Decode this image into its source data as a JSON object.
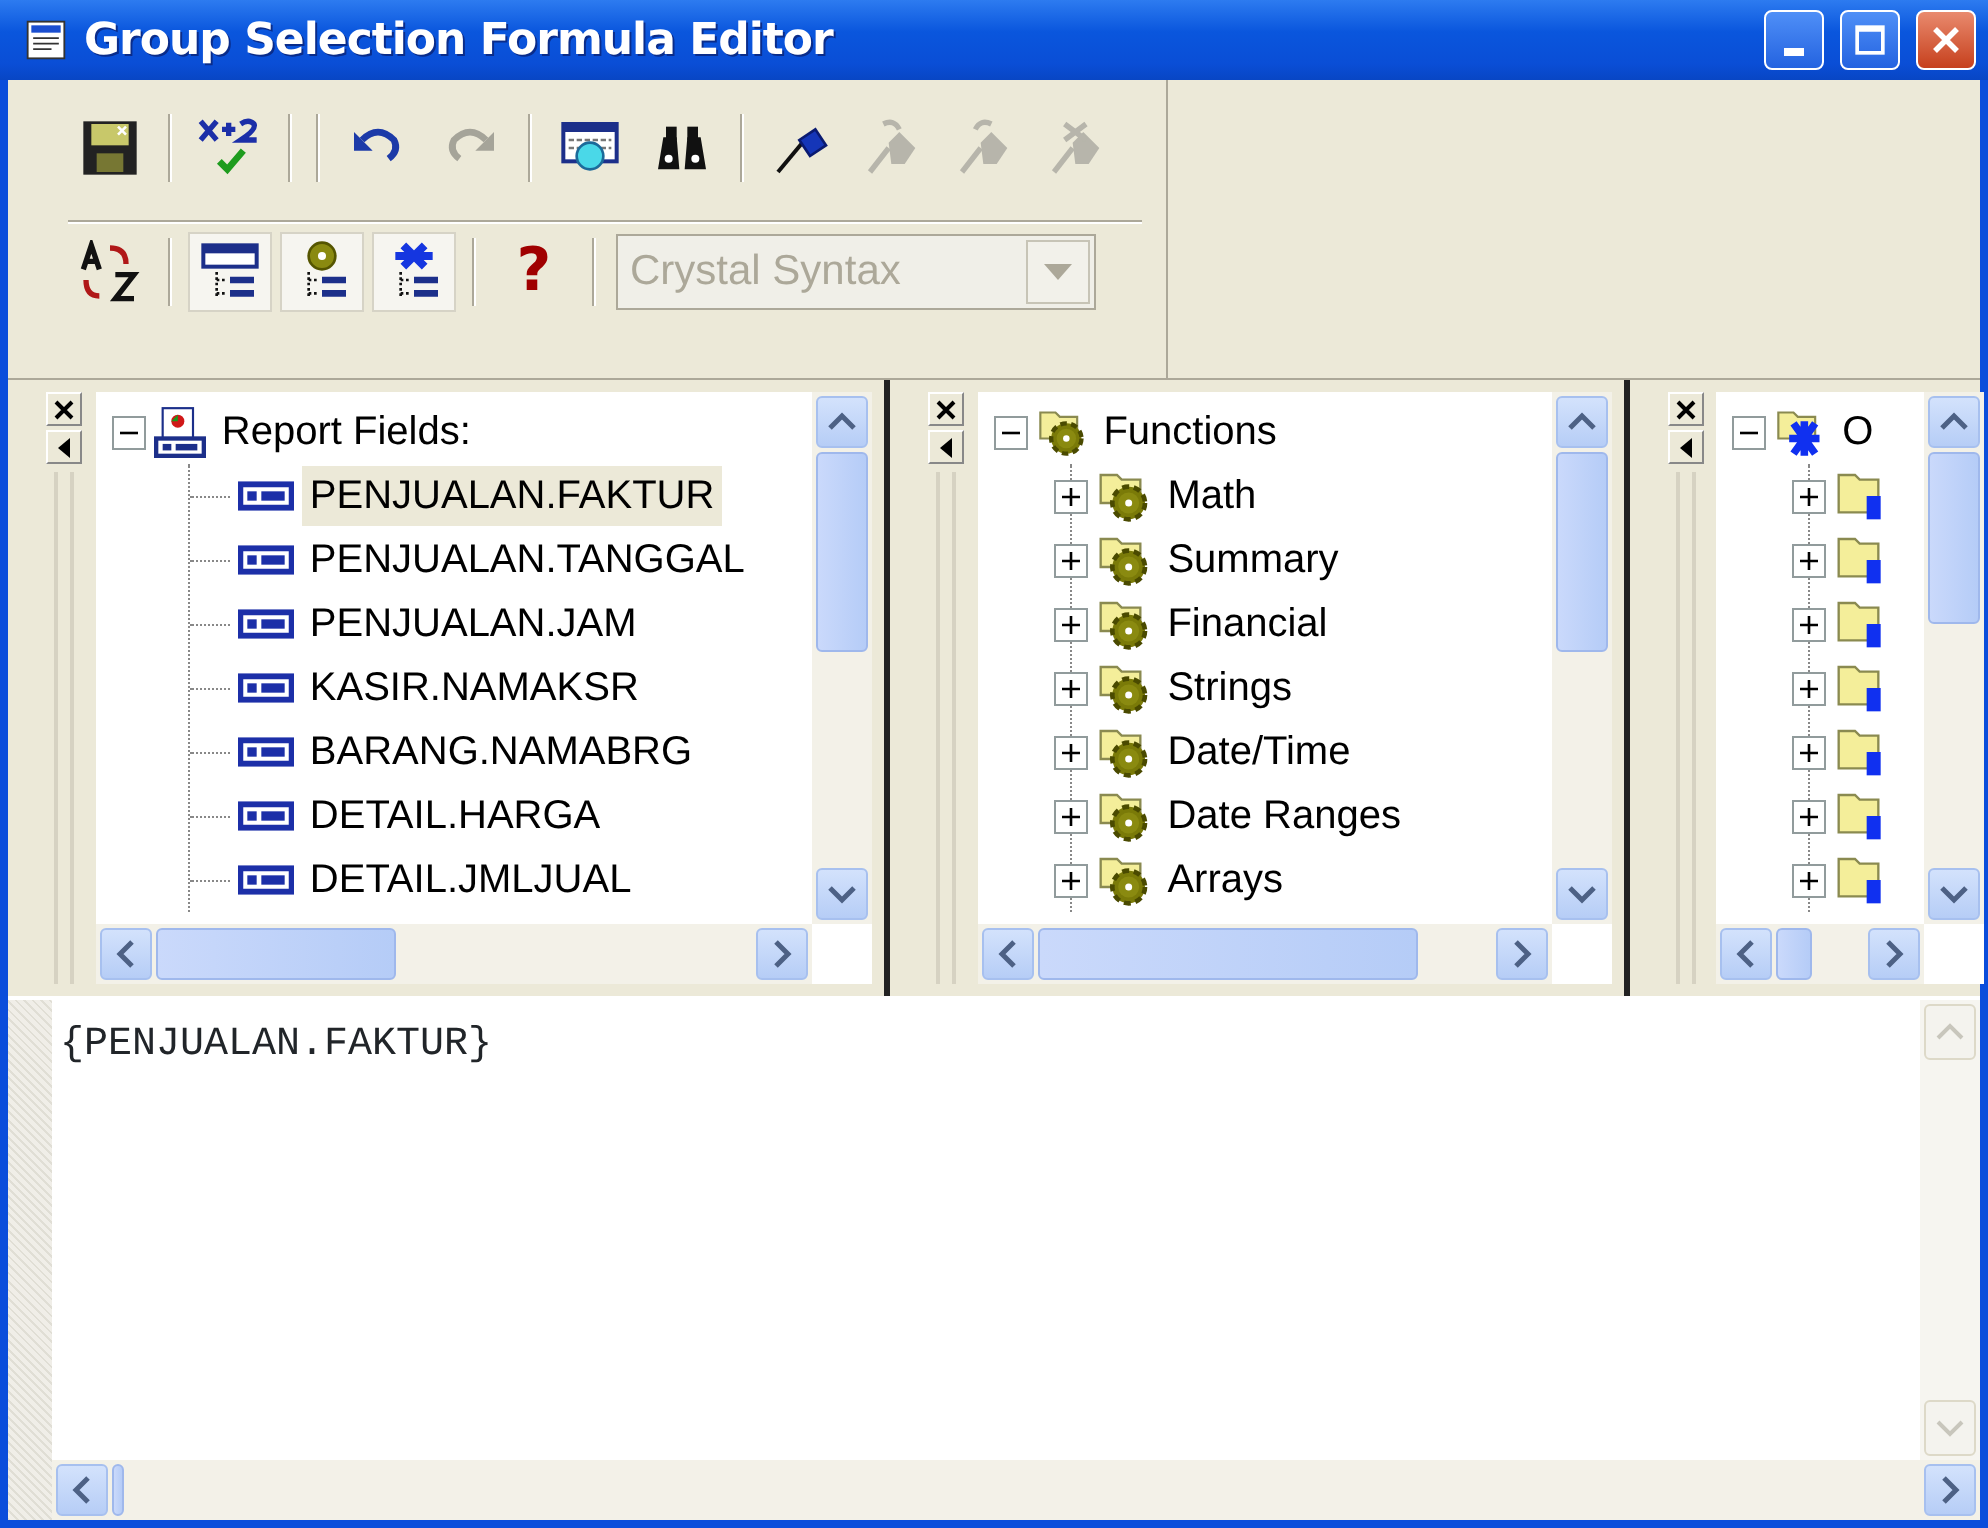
{
  "window": {
    "title": "Group Selection Formula Editor"
  },
  "toolbar": {
    "rows": [
      [
        {
          "kind": "button",
          "disabled": false
        },
        {
          "kind": "separator"
        },
        {
          "kind": "button",
          "disabled": false
        },
        {
          "kind": "separator"
        },
        {
          "kind": "separator"
        },
        {
          "kind": "button",
          "disabled": false
        },
        {
          "kind": "button",
          "disabled": true
        },
        {
          "kind": "separator"
        },
        {
          "kind": "button",
          "disabled": false
        },
        {
          "kind": "button",
          "disabled": false
        },
        {
          "kind": "separator"
        },
        {
          "kind": "button",
          "disabled": false
        },
        {
          "kind": "button",
          "disabled": true
        },
        {
          "kind": "button",
          "disabled": true
        },
        {
          "kind": "button",
          "disabled": true
        }
      ],
      [
        {
          "kind": "button",
          "disabled": false
        },
        {
          "kind": "separator"
        },
        {
          "kind": "toggle",
          "selected": true
        },
        {
          "kind": "toggle",
          "selected": true
        },
        {
          "kind": "toggle",
          "selected": true
        },
        {
          "kind": "separator"
        },
        {
          "kind": "button",
          "disabled": false,
          "label": "?"
        },
        {
          "kind": "separator"
        },
        {
          "kind": "dropdown",
          "value": "Crystal Syntax",
          "disabled": true
        }
      ]
    ]
  },
  "panes": [
    {
      "kind": "fields",
      "root": {
        "label": "Report Fields:",
        "expanded": true,
        "children": [
          {
            "label": "PENJUALAN.FAKTUR",
            "selected": true
          },
          {
            "label": "PENJUALAN.TANGGAL",
            "selected": false
          },
          {
            "label": "PENJUALAN.JAM",
            "selected": false
          },
          {
            "label": "KASIR.NAMAKSR",
            "selected": false
          },
          {
            "label": "BARANG.NAMABRG",
            "selected": false
          },
          {
            "label": "DETAIL.HARGA",
            "selected": false
          },
          {
            "label": "DETAIL.JMLJUAL",
            "selected": false
          }
        ]
      }
    },
    {
      "kind": "functions",
      "root": {
        "label": "Functions",
        "expanded": true,
        "children": [
          {
            "label": "Math",
            "expanded": false
          },
          {
            "label": "Summary",
            "expanded": false
          },
          {
            "label": "Financial",
            "expanded": false
          },
          {
            "label": "Strings",
            "expanded": false
          },
          {
            "label": "Date/Time",
            "expanded": false
          },
          {
            "label": "Date Ranges",
            "expanded": false
          },
          {
            "label": "Arrays",
            "expanded": false
          }
        ]
      }
    },
    {
      "kind": "operators",
      "root": {
        "label": "O",
        "expanded": true,
        "children": [
          {
            "expanded": false
          },
          {
            "expanded": false
          },
          {
            "expanded": false
          },
          {
            "expanded": false
          },
          {
            "expanded": false
          },
          {
            "expanded": false
          },
          {
            "expanded": false
          }
        ]
      }
    }
  ],
  "editor": {
    "text": "{PENJUALAN.FAKTUR}"
  }
}
